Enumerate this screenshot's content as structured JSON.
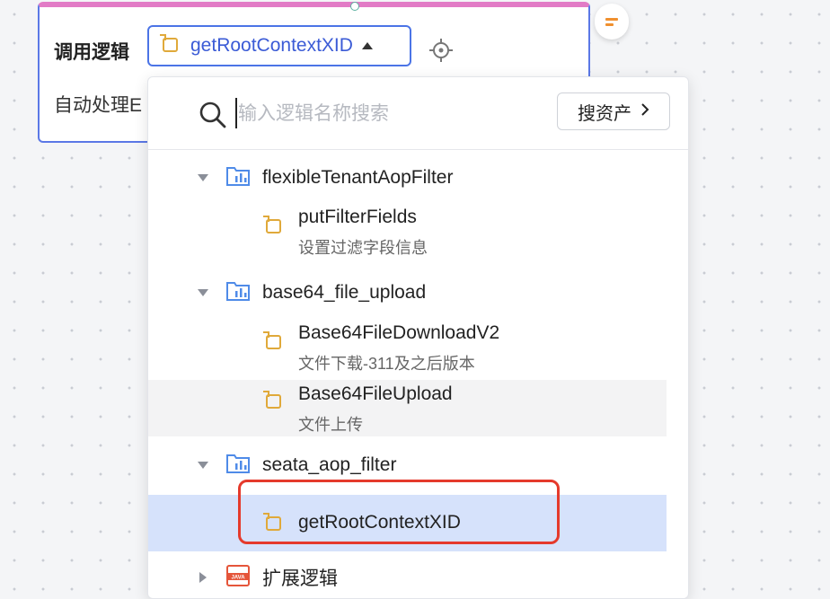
{
  "node": {
    "title": "调用逻辑",
    "subtitle": "自动处理E",
    "selected_logic": "getRootContextXID"
  },
  "search": {
    "placeholder": "输入逻辑名称搜索",
    "asset_button_label": "搜资产"
  },
  "tree": {
    "groups": [
      {
        "label": "flexibleTenantAopFilter",
        "expanded": true,
        "items": [
          {
            "label": "putFilterFields",
            "desc": "设置过滤字段信息"
          }
        ]
      },
      {
        "label": "base64_file_upload",
        "expanded": true,
        "items": [
          {
            "label": "Base64FileDownloadV2",
            "desc": "文件下载-311及之后版本"
          },
          {
            "label": "Base64FileUpload",
            "desc": "文件上传"
          }
        ]
      },
      {
        "label": "seata_aop_filter",
        "expanded": true,
        "items": [
          {
            "label": "getRootContextXID",
            "desc": ""
          }
        ]
      },
      {
        "label": "扩展逻辑",
        "expanded": false,
        "icon": "java-icon",
        "items": []
      }
    ]
  },
  "colors": {
    "accent": "#4b74e6",
    "node_top_border": "#e27bc6",
    "selected_row": "#d6e2fb",
    "highlight_box": "#e53a2c",
    "logic_icon": "#e0a93a"
  }
}
